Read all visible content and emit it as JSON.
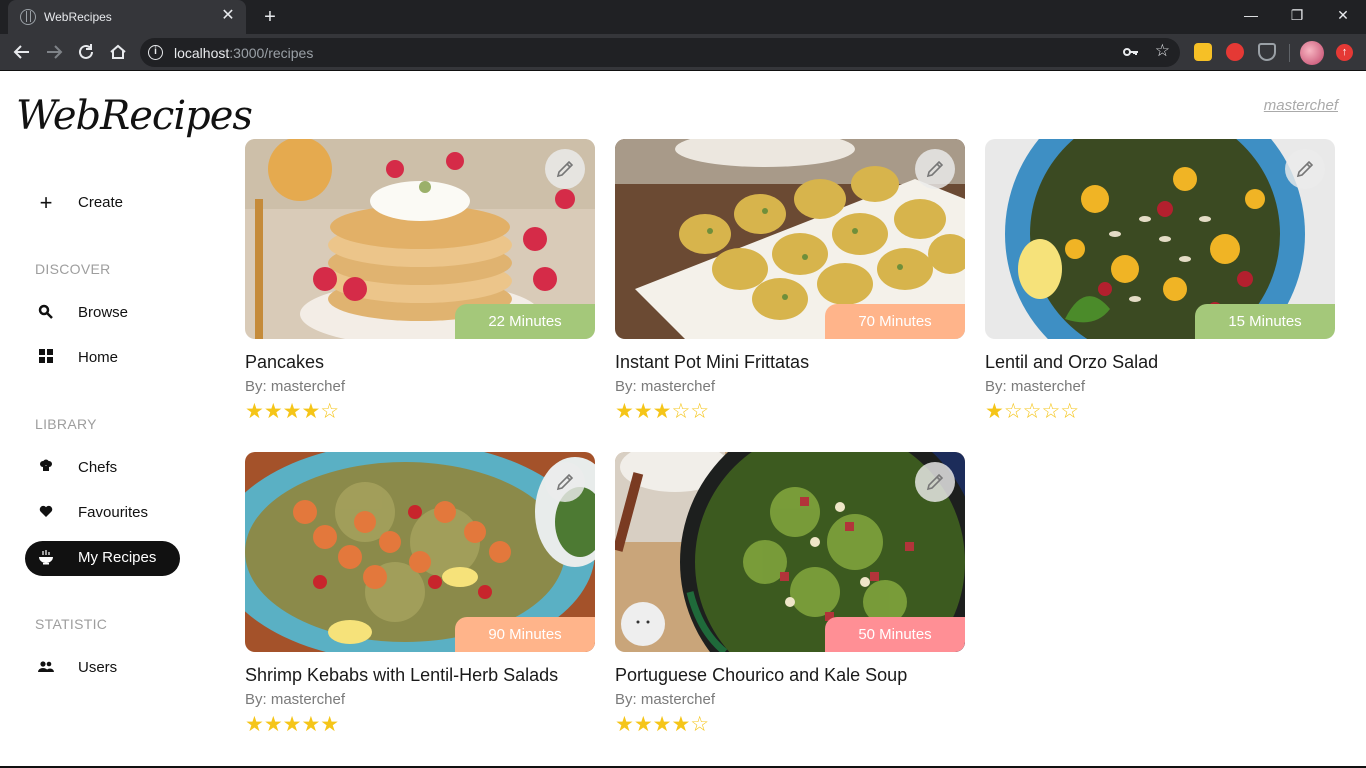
{
  "browser": {
    "tab_title": "WebRecipes",
    "tab_close": "✕",
    "new_tab": "+",
    "url_host": "localhost",
    "url_path": ":3000/recipes",
    "window_controls": [
      "—",
      "❐",
      "✕"
    ],
    "icons": [
      "back-icon",
      "forward-icon",
      "reload-icon",
      "home-icon",
      "info-icon",
      "key-icon",
      "star-icon"
    ]
  },
  "header": {
    "logo": "WebRecipes",
    "user": "masterchef"
  },
  "sidebar": {
    "create": {
      "label": "Create",
      "icon": "plus-icon",
      "glyph": "+"
    },
    "sections": [
      {
        "title": "DISCOVER",
        "items": [
          {
            "label": "Browse",
            "icon": "search-icon"
          },
          {
            "label": "Home",
            "icon": "grid-icon"
          }
        ]
      },
      {
        "title": "LIBRARY",
        "items": [
          {
            "label": "Chefs",
            "icon": "chef-hat-icon"
          },
          {
            "label": "Favourites",
            "icon": "heart-icon"
          },
          {
            "label": "My Recipes",
            "icon": "bowl-icon",
            "active": true
          }
        ]
      },
      {
        "title": "STATISTIC",
        "items": [
          {
            "label": "Users",
            "icon": "users-icon"
          }
        ]
      }
    ]
  },
  "recipes": [
    {
      "title": "Pancakes",
      "author": "By: masterchef",
      "time": "22 Minutes",
      "badge_color": "#a4c87a",
      "rating": 4,
      "max_rating": 5,
      "stars": "★★★★☆"
    },
    {
      "title": "Instant Pot Mini Frittatas",
      "author": "By: masterchef",
      "time": "70 Minutes",
      "badge_color": "#ffb48a",
      "rating": 3,
      "max_rating": 5,
      "stars": "★★★☆☆"
    },
    {
      "title": "Lentil and Orzo Salad",
      "author": "By: masterchef",
      "time": "15 Minutes",
      "badge_color": "#a4c87a",
      "rating": 1,
      "max_rating": 5,
      "stars": "★☆☆☆☆"
    },
    {
      "title": "Shrimp Kebabs with Lentil-Herb Salads",
      "author": "By: masterchef",
      "time": "90 Minutes",
      "badge_color": "#ffb48a",
      "rating": 5,
      "max_rating": 5,
      "stars": "★★★★★"
    },
    {
      "title": "Portuguese Chourico and Kale Soup",
      "author": "By: masterchef",
      "time": "50 Minutes",
      "badge_color": "#ff8f95",
      "rating": 4,
      "max_rating": 5,
      "stars": "★★★★☆"
    }
  ],
  "colors": {
    "chrome_dark": "#202124",
    "chrome_tab": "#35363a",
    "star": "#f5c518",
    "active_nav": "#111111",
    "section_label": "#9e9e9e"
  }
}
